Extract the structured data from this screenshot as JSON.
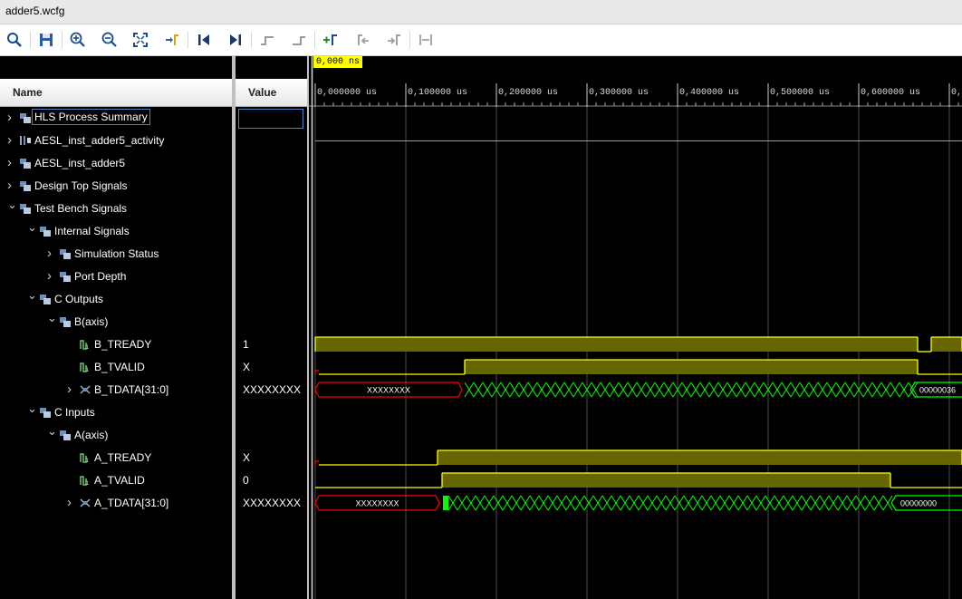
{
  "window": {
    "title": "adder5.wcfg"
  },
  "toolbar": {
    "icons": [
      "search-icon",
      "save-icon",
      "zoom-in-icon",
      "zoom-out-icon",
      "zoom-fit-icon",
      "goto-cursor-icon",
      "goto-start-icon",
      "goto-end-icon",
      "prev-transition-icon",
      "next-transition-icon",
      "add-marker-icon",
      "prev-marker-icon",
      "next-marker-icon",
      "swap-cursors-icon"
    ]
  },
  "columns": {
    "name": "Name",
    "value": "Value"
  },
  "cursor": {
    "label": "0,000 ns",
    "time_ns": 0
  },
  "timeline": {
    "ticks": [
      "0,000000 us",
      "0,100000 us",
      "0,200000 us",
      "0,300000 us",
      "0,400000 us",
      "0,500000 us",
      "0,600000 us",
      "0,"
    ]
  },
  "tree": [
    {
      "label": "HLS Process Summary",
      "value": "",
      "level": 0,
      "expanded": false,
      "icon": "group-icon",
      "selected": true
    },
    {
      "label": "AESL_inst_adder5_activity",
      "value": "",
      "level": 0,
      "expanded": false,
      "icon": "activity-icon"
    },
    {
      "label": "AESL_inst_adder5",
      "value": "",
      "level": 0,
      "expanded": false,
      "icon": "group-icon"
    },
    {
      "label": "Design Top Signals",
      "value": "",
      "level": 0,
      "expanded": false,
      "icon": "group-icon"
    },
    {
      "label": "Test Bench Signals",
      "value": "",
      "level": 0,
      "expanded": true,
      "icon": "group-icon"
    },
    {
      "label": "Internal Signals",
      "value": "",
      "level": 1,
      "expanded": true,
      "icon": "group-icon"
    },
    {
      "label": "Simulation Status",
      "value": "",
      "level": 2,
      "expanded": false,
      "icon": "group-icon"
    },
    {
      "label": "Port Depth",
      "value": "",
      "level": 2,
      "expanded": false,
      "icon": "group-icon"
    },
    {
      "label": "C Outputs",
      "value": "",
      "level": 1,
      "expanded": true,
      "icon": "group-icon"
    },
    {
      "label": "B(axis)",
      "value": "",
      "level": 2,
      "expanded": true,
      "icon": "group-icon"
    },
    {
      "label": "B_TREADY",
      "value": "1",
      "level": 3,
      "leaf": true,
      "icon": "signal-icon"
    },
    {
      "label": "B_TVALID",
      "value": "X",
      "level": 3,
      "leaf": true,
      "icon": "signal-icon"
    },
    {
      "label": "B_TDATA[31:0]",
      "value": "XXXXXXXX",
      "level": 3,
      "expanded": false,
      "icon": "bus-icon"
    },
    {
      "label": "C Inputs",
      "value": "",
      "level": 1,
      "expanded": true,
      "icon": "group-icon"
    },
    {
      "label": "A(axis)",
      "value": "",
      "level": 2,
      "expanded": true,
      "icon": "group-icon"
    },
    {
      "label": "A_TREADY",
      "value": "X",
      "level": 3,
      "leaf": true,
      "icon": "signal-icon"
    },
    {
      "label": "A_TVALID",
      "value": "0",
      "level": 3,
      "leaf": true,
      "icon": "signal-icon"
    },
    {
      "label": "A_TDATA[31:0]",
      "value": "XXXXXXXX",
      "level": 3,
      "expanded": false,
      "icon": "bus-icon"
    }
  ],
  "waves": {
    "B_TDATA": {
      "first_value": "XXXXXXXX",
      "last_value": "00000036"
    },
    "A_TDATA": {
      "first_value": "XXXXXXXX",
      "last_value": "00000000"
    }
  },
  "colors": {
    "signal": "#ffff00",
    "signal_fill": "#666600",
    "undefined": "#ff0000",
    "bus_change": "#00ff00",
    "activity": "#56b6b6"
  }
}
